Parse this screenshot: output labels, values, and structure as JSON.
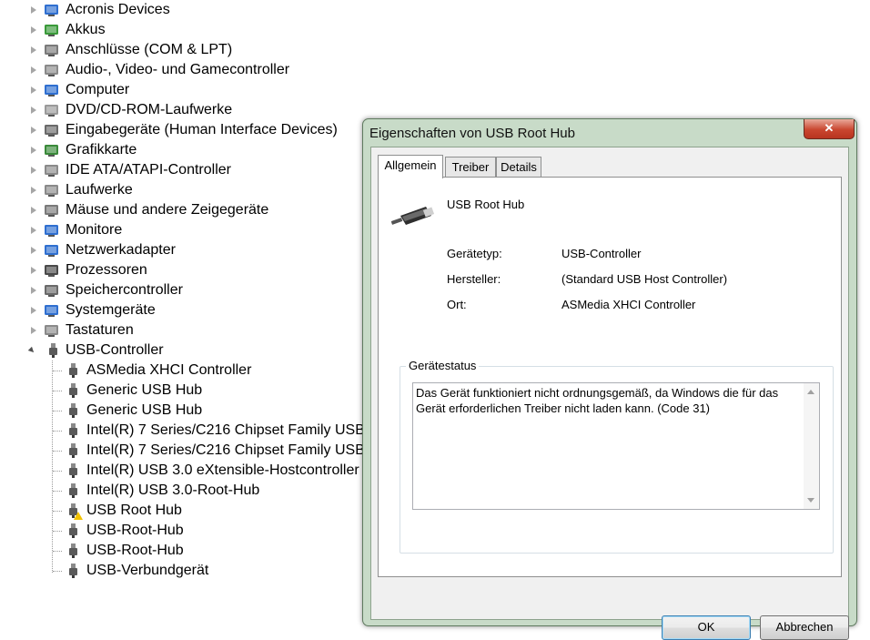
{
  "device_tree": {
    "categories": [
      {
        "label": "Acronis Devices",
        "icon": "network-computer-icon"
      },
      {
        "label": "Akkus",
        "icon": "battery-icon"
      },
      {
        "label": "Anschlüsse (COM & LPT)",
        "icon": "port-icon"
      },
      {
        "label": "Audio-, Video- und Gamecontroller",
        "icon": "speaker-icon"
      },
      {
        "label": "Computer",
        "icon": "computer-icon"
      },
      {
        "label": "DVD/CD-ROM-Laufwerke",
        "icon": "dvd-drive-icon"
      },
      {
        "label": "Eingabegeräte (Human Interface Devices)",
        "icon": "hid-icon"
      },
      {
        "label": "Grafikkarte",
        "icon": "display-adapter-icon"
      },
      {
        "label": "IDE ATA/ATAPI-Controller",
        "icon": "ide-controller-icon"
      },
      {
        "label": "Laufwerke",
        "icon": "disk-drive-icon"
      },
      {
        "label": "Mäuse und andere Zeigegeräte",
        "icon": "mouse-icon"
      },
      {
        "label": "Monitore",
        "icon": "monitor-icon"
      },
      {
        "label": "Netzwerkadapter",
        "icon": "network-adapter-icon"
      },
      {
        "label": "Prozessoren",
        "icon": "processor-icon"
      },
      {
        "label": "Speichercontroller",
        "icon": "storage-controller-icon"
      },
      {
        "label": "Systemgeräte",
        "icon": "system-device-icon"
      },
      {
        "label": "Tastaturen",
        "icon": "keyboard-icon"
      }
    ],
    "expanded_category": {
      "label": "USB-Controller",
      "icon": "usb-plug-icon"
    },
    "usb_children": [
      {
        "label": "ASMedia XHCI Controller",
        "warning": false
      },
      {
        "label": "Generic USB Hub",
        "warning": false
      },
      {
        "label": "Generic USB Hub",
        "warning": false
      },
      {
        "label": "Intel(R) 7 Series/C216 Chipset Family USB",
        "warning": false
      },
      {
        "label": "Intel(R) 7 Series/C216 Chipset Family USB",
        "warning": false
      },
      {
        "label": "Intel(R) USB 3.0 eXtensible-Hostcontroller",
        "warning": false
      },
      {
        "label": "Intel(R) USB 3.0-Root-Hub",
        "warning": false
      },
      {
        "label": "USB Root Hub",
        "warning": true
      },
      {
        "label": "USB-Root-Hub",
        "warning": false
      },
      {
        "label": "USB-Root-Hub",
        "warning": false
      },
      {
        "label": "USB-Verbundgerät",
        "warning": false
      }
    ]
  },
  "dialog": {
    "title": "Eigenschaften von USB Root Hub",
    "close_glyph": "✕",
    "tabs": [
      {
        "label": "Allgemein",
        "active": true
      },
      {
        "label": "Treiber",
        "active": false
      },
      {
        "label": "Details",
        "active": false
      }
    ],
    "device_name": "USB Root Hub",
    "device_icon": "usb-plug-icon",
    "properties": [
      {
        "label": "Gerätetyp:",
        "value": "USB-Controller"
      },
      {
        "label": "Hersteller:",
        "value": "(Standard USB Host Controller)"
      },
      {
        "label": "Ort:",
        "value": "ASMedia XHCI Controller"
      }
    ],
    "status_group_label": "Gerätestatus",
    "status_text": "Das Gerät funktioniert nicht ordnungsgemäß, da Windows die für das Gerät erforderlichen Treiber nicht laden kann. (Code 31)",
    "ok_label": "OK",
    "cancel_label": "Abbrechen"
  },
  "colors": {
    "window_frame": "#c8dbc8",
    "close_button": "#c9462f",
    "default_button_border": "#3c7fb1",
    "warning": "#f2c200"
  }
}
